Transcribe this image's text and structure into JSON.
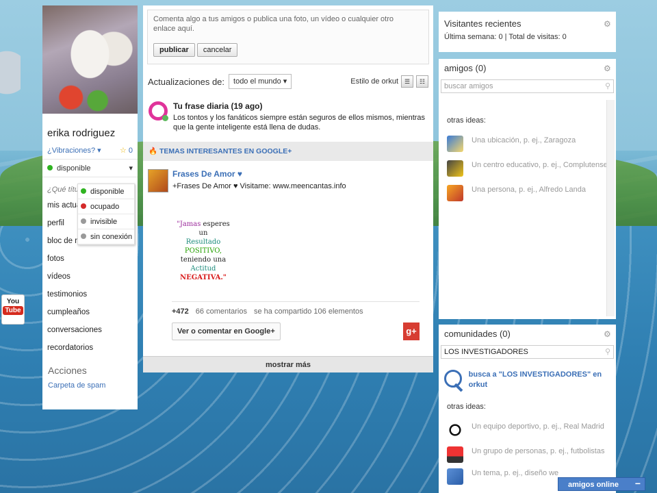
{
  "left": {
    "user_name": "erika rodriguez",
    "vibraciones": "¿Vibraciones? ▾",
    "star_count": "0",
    "status": "disponible",
    "status_menu": [
      "disponible",
      "ocupado",
      "invisible",
      "sin conexión"
    ],
    "que_titulo": "¿Qué títul",
    "nav": [
      "mis actua",
      "perfil",
      "bloc de notas",
      "fotos",
      "vídeos",
      "testimonios",
      "cumpleaños",
      "conversaciones",
      "recordatorios"
    ],
    "acciones": "Acciones",
    "spam": "Carpeta de spam"
  },
  "youtube": {
    "top": "You",
    "bottom": "Tube"
  },
  "center": {
    "compose_placeholder": "Comenta algo a tus amigos o publica una foto, un vídeo o cualquier otro enlace aquí.",
    "publish_btn": "publicar",
    "cancel_btn": "cancelar",
    "updates_label": "Actualizaciones de:",
    "updates_filter": "todo el mundo ▾",
    "orkut_style": "Estilo de orkut",
    "frase_title": "Tu frase diaria (19 ago)",
    "frase_text": "Los tontos y los fanáticos siempre están seguros de ellos mismos, mientras que la gente inteligente está llena de dudas.",
    "google_header": "TEMAS INTERESANTES EN GOOGLE+",
    "post": {
      "author": "Frases De Amor ♥",
      "desc": "+Frases De Amor ♥ Visitame: www.meencantas.info",
      "quote": {
        "l1a": "\"Jamas",
        "l1b": " esperes un",
        "l2": "Resultado",
        "l3": "POSITIVO,",
        "l4": "teniendo una",
        "l5": "Actitud",
        "l6": "NEGATIVA.\""
      },
      "plus": "+472",
      "comments": "66 comentarios",
      "shared": "se ha compartido 106 elementos",
      "gplus_btn": "Ver o comentar en Google+",
      "gplus_icon": "g+"
    },
    "show_more": "mostrar más"
  },
  "right": {
    "visitors_title": "Visitantes recientes",
    "visitors_stats": "Última semana: 0 | Total de visitas: 0",
    "friends_title": "amigos (0)",
    "friends_search_placeholder": "buscar amigos",
    "otras_ideas": "otras ideas:",
    "friend_ideas": [
      "Una ubicación, p. ej., Zaragoza",
      "Un centro educativo, p. ej., Complutense",
      "Una persona, p. ej., Alfredo Landa"
    ],
    "comms_title": "comunidades (0)",
    "comms_search_value": "LOS INVESTIGADORES",
    "comms_search_result": "busca a \"LOS INVESTIGADORES\" en orkut",
    "comm_ideas": [
      "Un equipo deportivo, p. ej., Real Madrid",
      "Un grupo de personas, p. ej., futbolistas",
      "Un tema, p. ej., diseño we"
    ]
  },
  "online_bar": {
    "label": "amigos online",
    "minus": "−"
  }
}
